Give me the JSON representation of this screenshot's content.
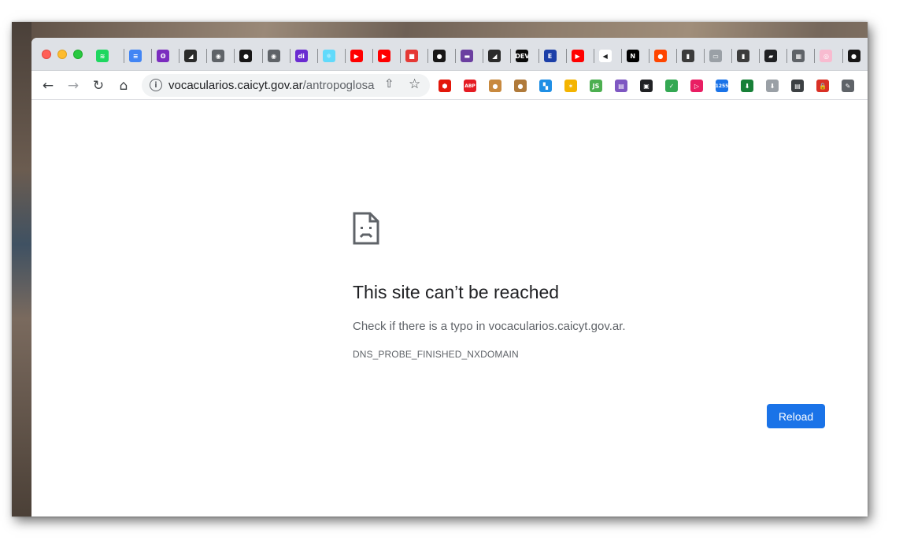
{
  "browser": {
    "tabs": [
      {
        "icon": "spotify-icon",
        "color": "#1ed760",
        "glyph": "≋"
      },
      {
        "icon": "google-docs-icon",
        "color": "#4285f4",
        "glyph": "≡"
      },
      {
        "icon": "app-purple-icon",
        "color": "#7b2cbf",
        "glyph": "ʘ"
      },
      {
        "icon": "dark-bird-icon",
        "color": "#2b2b2b",
        "glyph": "◢"
      },
      {
        "icon": "globe-icon",
        "color": "#5f6368",
        "glyph": "◉"
      },
      {
        "icon": "github-icon",
        "color": "#181717",
        "glyph": "●"
      },
      {
        "icon": "globe-icon",
        "color": "#5f6368",
        "glyph": "◉"
      },
      {
        "icon": "di-icon",
        "color": "#6a2bd1",
        "glyph": "di"
      },
      {
        "icon": "react-icon",
        "color": "#61dafb",
        "glyph": "⚛"
      },
      {
        "icon": "youtube-icon",
        "color": "#ff0000",
        "glyph": "▶"
      },
      {
        "icon": "youtube-icon",
        "color": "#ff0000",
        "glyph": "▶"
      },
      {
        "icon": "red-app-icon",
        "color": "#e53935",
        "glyph": "■"
      },
      {
        "icon": "github-icon",
        "color": "#181717",
        "glyph": "●"
      },
      {
        "icon": "purple-square-icon",
        "color": "#6b3fa0",
        "glyph": "▬"
      },
      {
        "icon": "dark-bird-icon",
        "color": "#2b2b2b",
        "glyph": "◢"
      },
      {
        "icon": "dev-icon",
        "color": "#0a0a0a",
        "glyph": "DEV"
      },
      {
        "icon": "e-icon",
        "color": "#1c3fa8",
        "glyph": "E"
      },
      {
        "icon": "youtube-icon",
        "color": "#ff0000",
        "glyph": "▶"
      },
      {
        "icon": "speaker-icon",
        "color": "#ffffff",
        "glyph": "◀"
      },
      {
        "icon": "notion-icon",
        "color": "#000000",
        "glyph": "N"
      },
      {
        "icon": "reddit-icon",
        "color": "#ff4500",
        "glyph": "●"
      },
      {
        "icon": "book-icon",
        "color": "#3c3c3c",
        "glyph": "▮"
      },
      {
        "icon": "open-book-icon",
        "color": "#9aa0a6",
        "glyph": "▭"
      },
      {
        "icon": "book-icon",
        "color": "#3c3c3c",
        "glyph": "▮"
      },
      {
        "icon": "notebook-icon",
        "color": "#202124",
        "glyph": "▰"
      },
      {
        "icon": "reader-icon",
        "color": "#5f6368",
        "glyph": "▦"
      },
      {
        "icon": "pink-brain-icon",
        "color": "#f8bbd0",
        "glyph": "◎"
      },
      {
        "icon": "github-icon",
        "color": "#181717",
        "glyph": "●"
      }
    ],
    "nav": {
      "back": "←",
      "forward": "→",
      "reload": "↻",
      "home": "⌂"
    },
    "omnibox": {
      "domain": "vocacularios.caicyt.gov.ar",
      "path": "/antropoglosa"
    },
    "extensions": [
      {
        "icon": "ublock-icon",
        "color": "#e3170a",
        "glyph": "⬢"
      },
      {
        "icon": "adblock-plus-icon",
        "color": "#e51c23",
        "glyph": "ABP"
      },
      {
        "icon": "cookie-icon",
        "color": "#c8893e",
        "glyph": "●"
      },
      {
        "icon": "cookie-icon",
        "color": "#b07a3a",
        "glyph": "●"
      },
      {
        "icon": "window-icon",
        "color": "#1f8fe5",
        "glyph": "▚"
      },
      {
        "icon": "orange-star-icon",
        "color": "#f4b400",
        "glyph": "✶"
      },
      {
        "icon": "js-icon",
        "color": "#4caf50",
        "glyph": "JS"
      },
      {
        "icon": "purple-window-icon",
        "color": "#7e57c2",
        "glyph": "▤"
      },
      {
        "icon": "picture-in-picture-icon",
        "color": "#202124",
        "glyph": "▣"
      },
      {
        "icon": "checkmark-icon",
        "color": "#34a853",
        "glyph": "✓"
      },
      {
        "icon": "play-icon",
        "color": "#e91e63",
        "glyph": "▷"
      },
      {
        "icon": "graduation-cap-icon",
        "color": "#1a73e8",
        "glyph": "1255"
      },
      {
        "icon": "download-arrow-icon",
        "color": "#188038",
        "glyph": "⬇"
      },
      {
        "icon": "download-circle-icon",
        "color": "#9aa0a6",
        "glyph": "⬇"
      },
      {
        "icon": "reader-mode-icon",
        "color": "#3c4043",
        "glyph": "▤"
      },
      {
        "icon": "lock-icon",
        "color": "#d93025",
        "glyph": "🔒"
      },
      {
        "icon": "pencil-icon",
        "color": "#5f6368",
        "glyph": "✎"
      }
    ]
  },
  "error_page": {
    "title": "This site can’t be reached",
    "message": "Check if there is a typo in vocacularios.caicyt.gov.ar.",
    "code": "DNS_PROBE_FINISHED_NXDOMAIN",
    "reload_label": "Reload"
  },
  "colors": {
    "accent": "#1a73e8",
    "title_text": "#202124",
    "secondary_text": "#5f6368"
  }
}
